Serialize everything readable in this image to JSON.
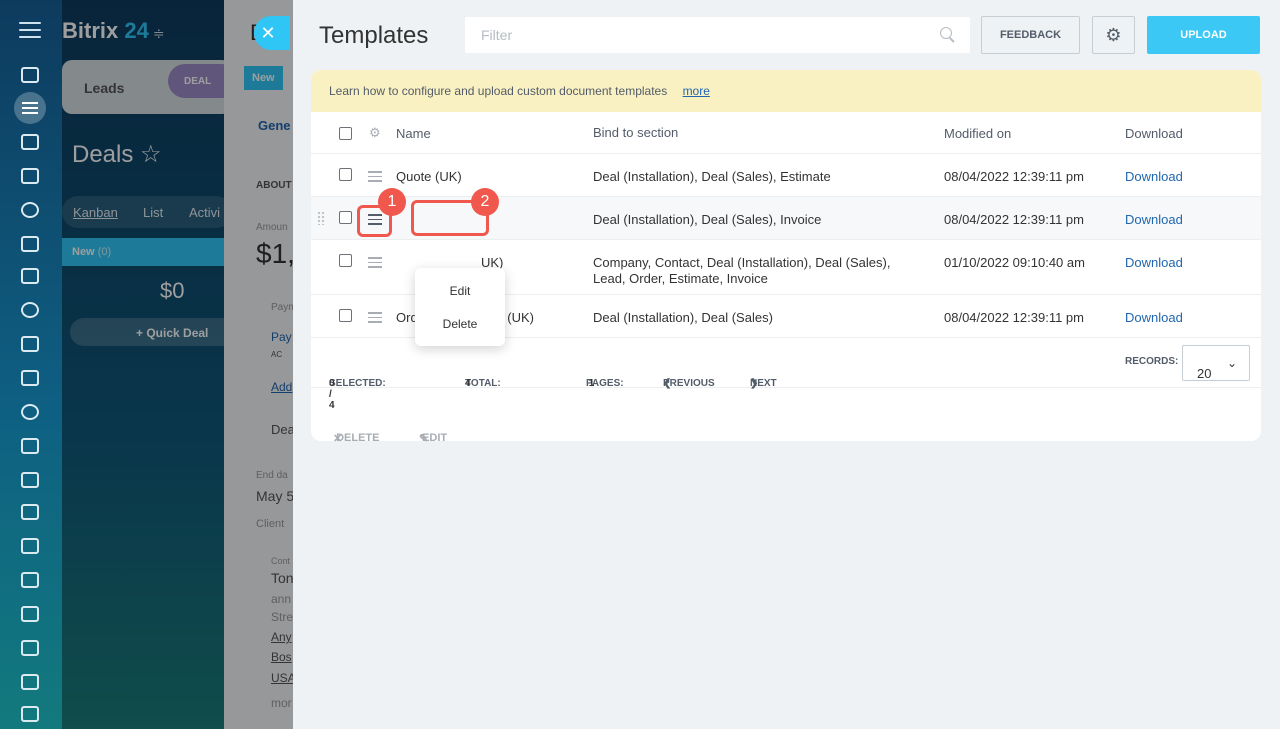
{
  "background": {
    "app_name": "Bitrix",
    "app_number": "24",
    "stage_leads": "Leads",
    "stage_deal": "DEAL",
    "page_title": "Deals",
    "view_tabs": [
      "Kanban",
      "List",
      "Activi"
    ],
    "column_name": "New",
    "column_count": "(0)",
    "column_sum": "$0",
    "quick_deal": "Quick Deal",
    "card_fragments": [
      "D",
      "New",
      "Gene",
      "ABOUT",
      "Amoun",
      "$1,",
      "Paym",
      "Pay",
      "AC",
      "Add",
      "Dea",
      "End da",
      "May 5",
      "Client",
      "Cont",
      "Ton",
      "ann",
      "Stre",
      "Any",
      "Bos",
      "USA",
      "mor"
    ]
  },
  "slider": {
    "title": "Templates",
    "filter_placeholder": "Filter",
    "feedback_label": "FEEDBACK",
    "upload_label": "UPLOAD",
    "banner_text": "Learn how to configure and upload custom document templates",
    "banner_link": "more",
    "columns": [
      "Name",
      "Bind to section",
      "Modified on",
      "Download"
    ],
    "rows": [
      {
        "name": "Quote (UK)",
        "section": "Deal (Installation), Deal (Sales), Estimate",
        "modified": "08/04/2022 12:39:11 pm",
        "download": "Download"
      },
      {
        "name": "",
        "section": "Deal (Installation), Deal (Sales), Invoice",
        "modified": "08/04/2022 12:39:11 pm",
        "download": "Download"
      },
      {
        "name": "UK)",
        "section": "Company, Contact, Deal (Installation), Deal (Sales), Lead, Order, Estimate, Invoice",
        "modified": "01/10/2022 09:10:40 am",
        "download": "Download"
      },
      {
        "name": "Order confirmation (UK)",
        "section": "Deal (Installation), Deal (Sales)",
        "modified": "08/04/2022 12:39:11 pm",
        "download": "Download"
      }
    ],
    "footer": {
      "selected_label": "SELECTED:",
      "selected_value": "0 / 4",
      "total_label": "TOTAL:",
      "total_value": "4",
      "pages_label": "PAGES:",
      "pages_value": "1",
      "previous": "PREVIOUS",
      "next": "NEXT",
      "records_label": "RECORDS:",
      "records_value": "20"
    },
    "actions": {
      "delete": "DELETE",
      "edit": "EDIT"
    },
    "context_menu": {
      "edit": "Edit",
      "delete": "Delete"
    },
    "annotations": {
      "step1": "1",
      "step2": "2"
    }
  },
  "colors": {
    "accent": "#3bc8f5",
    "link": "#2067b0",
    "marker": "#f0584e",
    "banner": "#f9f1c2"
  }
}
